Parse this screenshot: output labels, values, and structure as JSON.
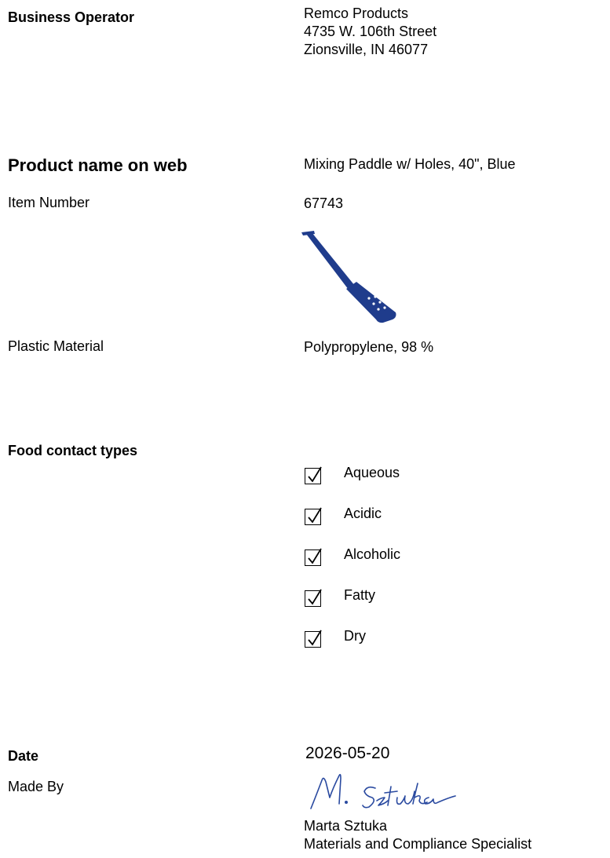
{
  "business_operator": {
    "label": "Business Operator",
    "address": [
      "Remco Products",
      "4735 W. 106th Street",
      "Zionsville, IN 46077"
    ]
  },
  "product": {
    "name_label": "Product name on web",
    "name_value": "Mixing Paddle w/ Holes, 40\", Blue",
    "item_label": "Item Number",
    "item_value": "67743",
    "image_icon": "mixing-paddle-image",
    "image_color": "#1f3c8c",
    "material_label": "Plastic Material",
    "material_value": "Polypropylene, 98 %"
  },
  "food_contact": {
    "label": "Food contact types",
    "types": [
      {
        "label": "Aqueous",
        "checked": true
      },
      {
        "label": "Acidic",
        "checked": true
      },
      {
        "label": "Alcoholic",
        "checked": true
      },
      {
        "label": "Fatty",
        "checked": true
      },
      {
        "label": "Dry",
        "checked": true
      }
    ]
  },
  "date": {
    "label": "Date",
    "value": "2026-05-20"
  },
  "made_by": {
    "label": "Made By",
    "signature_text": "M. Sztuka",
    "signature_color": "#2a4aa0",
    "name": "Marta Sztuka",
    "title": "Materials and Compliance Specialist"
  }
}
